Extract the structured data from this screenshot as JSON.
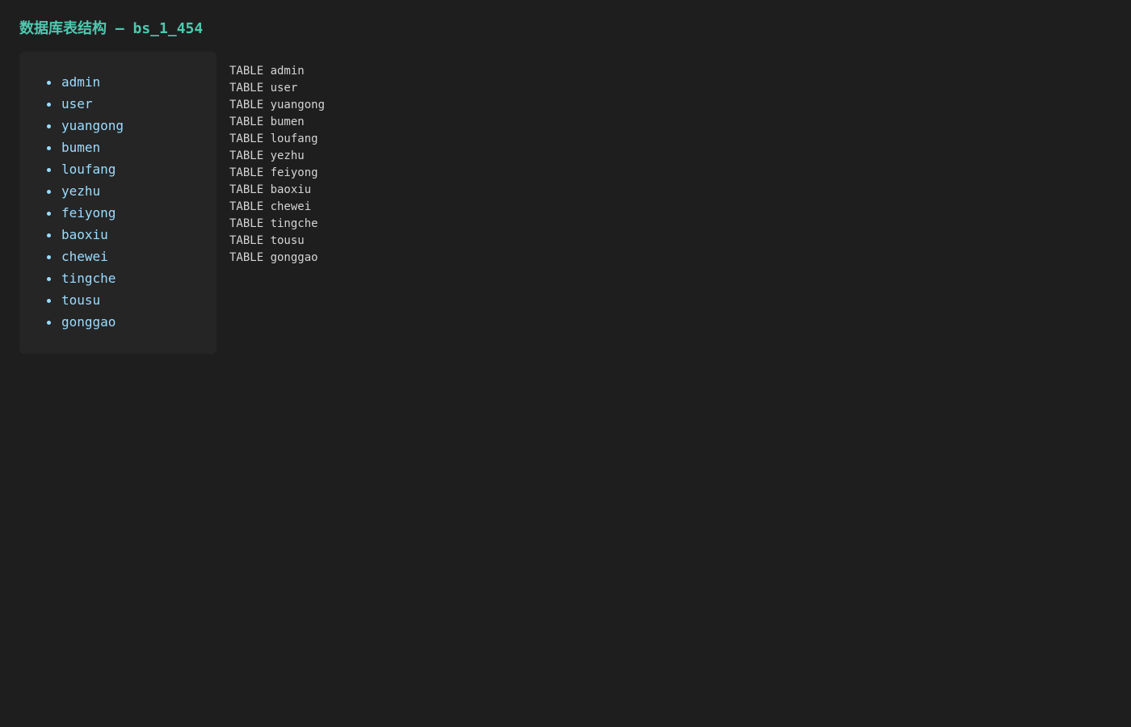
{
  "page": {
    "title": "数据库表结构 — bs_1_454"
  },
  "sidebar": {
    "tables": [
      {
        "name": "admin"
      },
      {
        "name": "user"
      },
      {
        "name": "yuangong"
      },
      {
        "name": "bumen"
      },
      {
        "name": "loufang"
      },
      {
        "name": "yezhu"
      },
      {
        "name": "feiyong"
      },
      {
        "name": "baoxiu"
      },
      {
        "name": "chewei"
      },
      {
        "name": "tingche"
      },
      {
        "name": "tousu"
      },
      {
        "name": "gonggao"
      }
    ]
  },
  "schema": {
    "lines": [
      "TABLE admin",
      "TABLE user",
      "TABLE yuangong",
      "TABLE bumen",
      "TABLE loufang",
      "TABLE yezhu",
      "TABLE feiyong",
      "TABLE baoxiu",
      "TABLE chewei",
      "TABLE tingche",
      "TABLE tousu",
      "TABLE gonggao"
    ]
  },
  "colors": {
    "background": "#1e1e1e",
    "panel": "#252526",
    "title": "#4ec9b0",
    "link": "#9cdcfe",
    "text": "#d4d4d4"
  }
}
